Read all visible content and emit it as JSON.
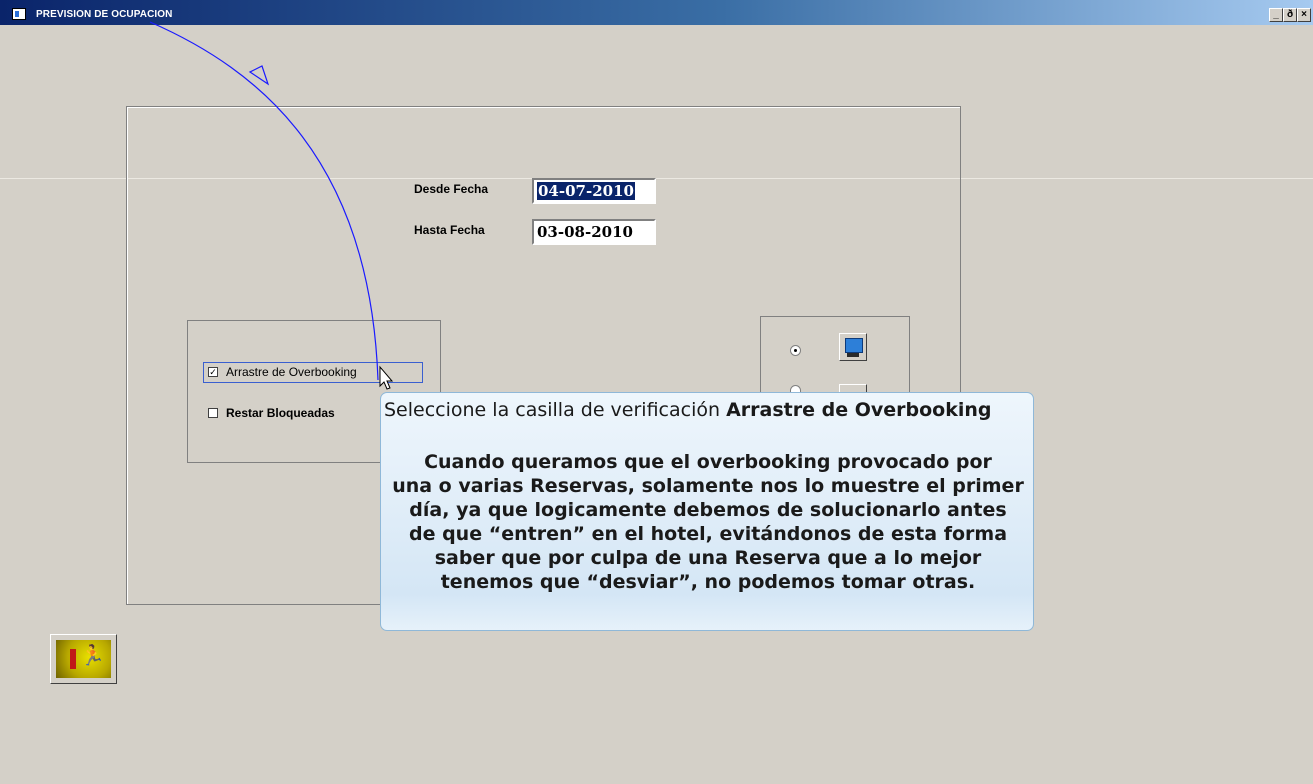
{
  "window": {
    "title": "PREVISION DE OCUPACION",
    "btn_min": "_",
    "btn_max": "ð",
    "btn_close": "×"
  },
  "dates": {
    "from_label": "Desde  Fecha",
    "from_value": "04-07-2010",
    "to_label": "Hasta  Fecha",
    "to_value": "03-08-2010"
  },
  "options": {
    "overbooking_label": "Arrastre de Overbooking",
    "overbooking_checked": true,
    "blocked_label": "Restar Bloqueadas",
    "blocked_checked": false
  },
  "output": {
    "screen_selected": true,
    "screen_icon": "monitor-icon",
    "printer_icon": "printer-icon"
  },
  "exit": {
    "icon": "exit-door-icon"
  },
  "tooltip": {
    "title_prefix": "Seleccione la casilla de verificación ",
    "title_bold": "Arrastre de Overbooking",
    "body": "Cuando queramos que el overbooking provocado por\nuna o varias Reservas, solamente nos lo muestre el primer\ndía, ya que logicamente debemos de solucionarlo antes\nde que “entren” en el hotel, evitándonos de esta forma\nsaber que por culpa de una Reserva que a lo mejor\ntenemos que “desviar”, no podemos tomar otras."
  },
  "colors": {
    "window_bg": "#d4d0c8",
    "titlebar_start": "#0a246a",
    "selection": "#0a246a",
    "pointer_arc": "#1a1aff",
    "tooltip_bg": "#e3eff9"
  }
}
